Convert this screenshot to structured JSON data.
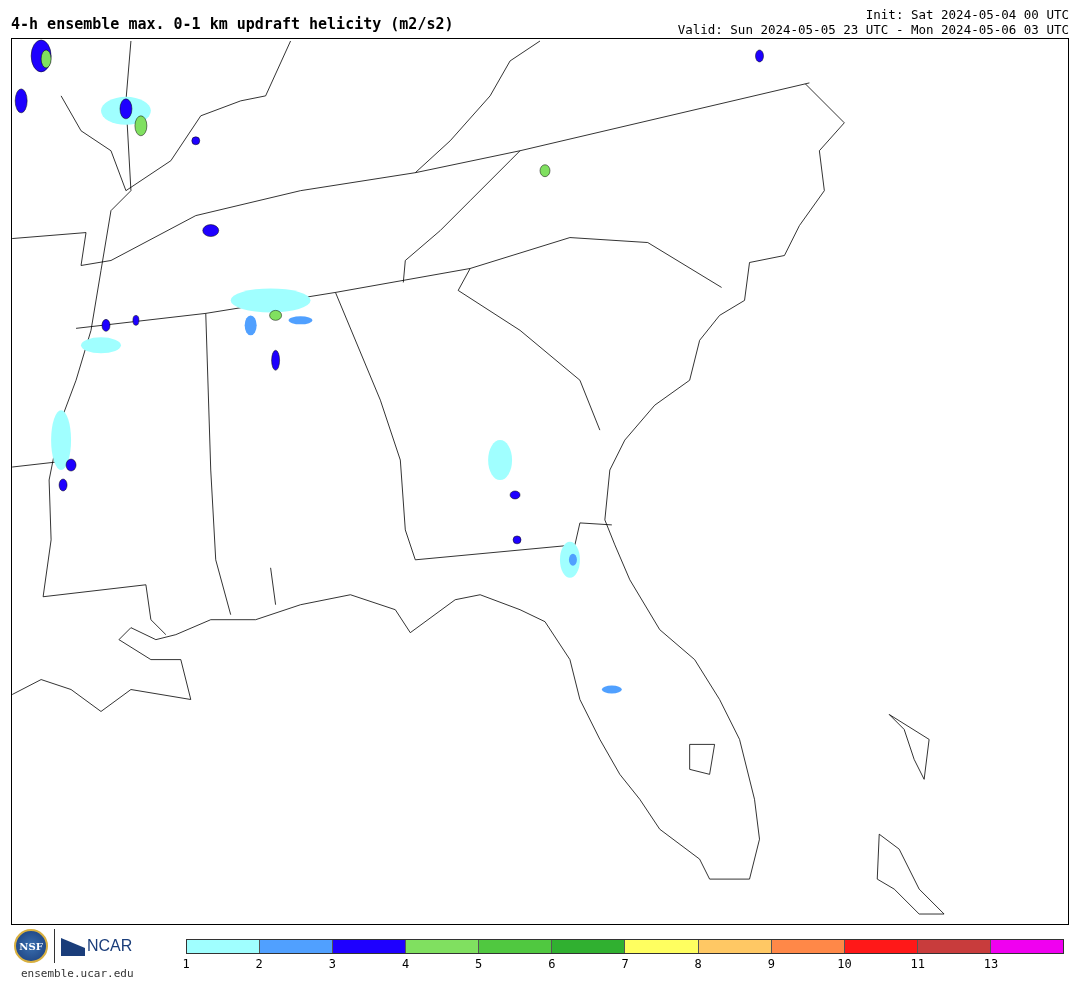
{
  "title": "4-h ensemble max. 0-1 km updraft helicity (m2/s2)",
  "init": "Init: Sat 2024-05-04 00 UTC",
  "valid": "Valid: Sun 2024-05-05 23 UTC - Mon 2024-05-06 03 UTC",
  "logos": {
    "nsf": "NSF",
    "ncar": "NCAR"
  },
  "url": "ensemble.ucar.edu",
  "legend": {
    "bins": [
      {
        "color": "#a0ffff"
      },
      {
        "color": "#50a0ff"
      },
      {
        "color": "#1e00ff"
      },
      {
        "color": "#80e060"
      },
      {
        "color": "#50c840"
      },
      {
        "color": "#30b030"
      },
      {
        "color": "#ffff60"
      },
      {
        "color": "#ffc864"
      },
      {
        "color": "#ff8848"
      },
      {
        "color": "#ff1818"
      },
      {
        "color": "#c83c3c"
      },
      {
        "color": "#f000f0"
      }
    ],
    "ticks": [
      "1",
      "2",
      "3",
      "4",
      "5",
      "6",
      "7",
      "8",
      "9",
      "10",
      "11",
      "13"
    ]
  }
}
